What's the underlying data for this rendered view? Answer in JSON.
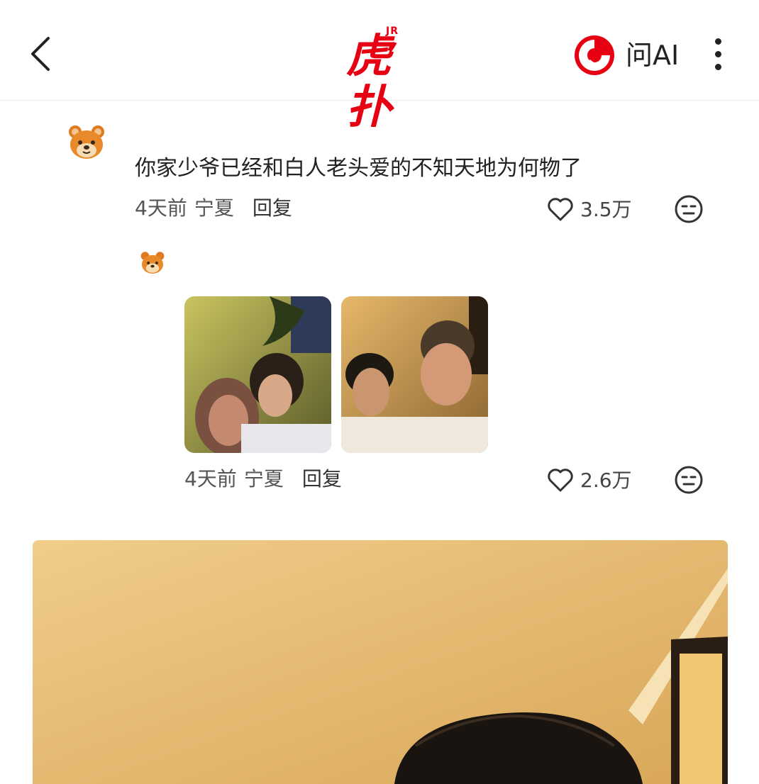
{
  "header": {
    "logo": {
      "text": "虎扑",
      "badge": "JR",
      "color": "#e60012"
    },
    "ask_ai_label": "问AI"
  },
  "comment": {
    "text": "你家少爷已经和白人老头爱的不知天地为何物了",
    "time": "4天前",
    "location": "宁夏",
    "reply_label": "回复",
    "likes": "3.5万"
  },
  "sub_comment": {
    "time": "4天前",
    "location": "宁夏",
    "reply_label": "回复",
    "likes": "2.6万",
    "images": 2
  },
  "icons": {
    "back": "chevron-left-icon",
    "more": "vertical-dots-icon",
    "like": "heart-outline-icon",
    "emoji": "neutral-face-icon",
    "avatar": "bear-avatar-icon",
    "ai": "red-swirl-logo-icon"
  },
  "colors": {
    "brand": "#e60012",
    "text": "#222222",
    "meta": "#555555"
  }
}
